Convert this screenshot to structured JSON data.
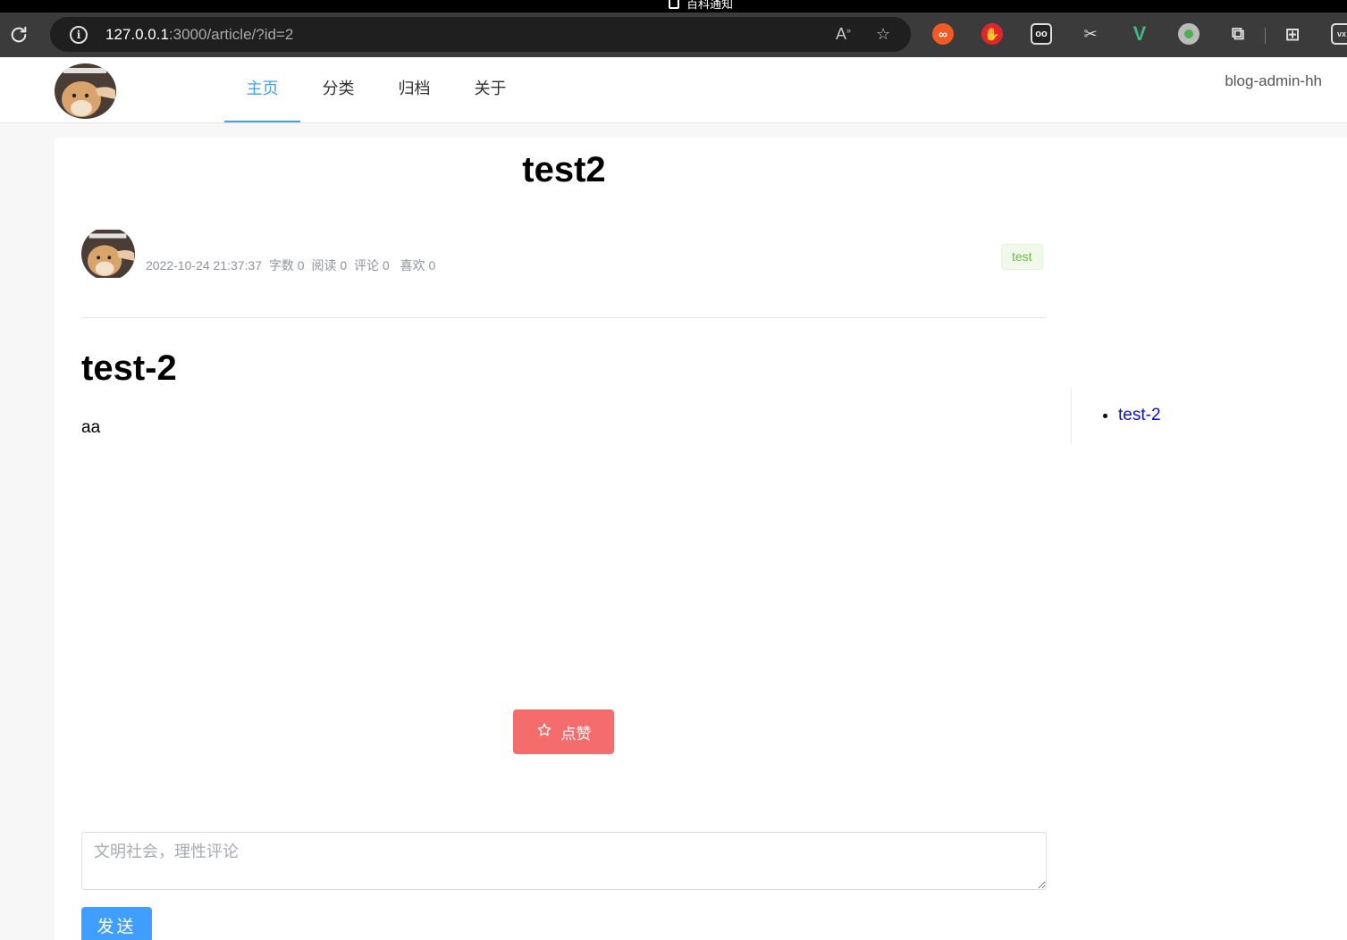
{
  "window": {
    "title": "百科通知"
  },
  "browser": {
    "url_host": "127.0.0.1",
    "url_rest": ":3000/article/?id=2",
    "icons": [
      "reload-icon",
      "info-icon",
      "read-aloud-icon",
      "favorite-icon",
      "extensions-icon",
      "collections-icon"
    ]
  },
  "site": {
    "nav": [
      "主页",
      "分类",
      "归档",
      "关于"
    ],
    "active_nav": "主页",
    "user": "blog-admin-hh",
    "accent": "#409eff"
  },
  "article": {
    "title": "test2",
    "date": "2022-10-24 21:37:37",
    "word_count": "字数 0",
    "reads": "阅读 0",
    "comments": "评论 0",
    "likes": "喜欢 0",
    "tag": "test",
    "heading": "test-2",
    "body": "aa"
  },
  "toc": {
    "items": [
      "test-2"
    ]
  },
  "actions": {
    "like_label": "点赞",
    "like_color": "#f56c6c",
    "comment_placeholder": "文明社会，理性评论",
    "send_label": "发送"
  }
}
